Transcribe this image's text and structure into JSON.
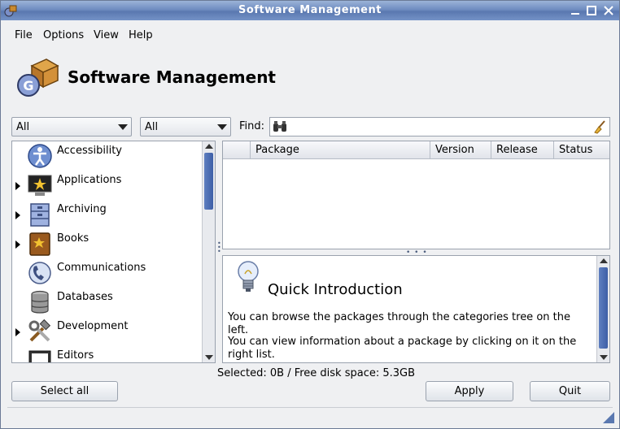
{
  "window": {
    "title": "Software Management"
  },
  "menubar": {
    "items": [
      "File",
      "Options",
      "View",
      "Help"
    ]
  },
  "header": {
    "title": "Software Management"
  },
  "filters": {
    "combo1": "All",
    "combo2": "All",
    "find_label": "Find:",
    "find_value": ""
  },
  "categories": [
    {
      "label": "Accessibility",
      "icon": "accessibility-icon",
      "expandable": false
    },
    {
      "label": "Applications",
      "icon": "applications-icon",
      "expandable": true
    },
    {
      "label": "Archiving",
      "icon": "archiving-icon",
      "expandable": true
    },
    {
      "label": "Books",
      "icon": "books-icon",
      "expandable": true
    },
    {
      "label": "Communications",
      "icon": "communications-icon",
      "expandable": false
    },
    {
      "label": "Databases",
      "icon": "databases-icon",
      "expandable": false
    },
    {
      "label": "Development",
      "icon": "development-icon",
      "expandable": true
    },
    {
      "label": "Editors",
      "icon": "editors-icon",
      "expandable": false
    }
  ],
  "package_list": {
    "columns": [
      "Package",
      "Version",
      "Release",
      "Status"
    ],
    "rows": []
  },
  "info": {
    "title": "Quick Introduction",
    "paragraphs": [
      "You can browse the packages through the categories tree on the left.",
      "You can view information about a package by clicking on it on the right list."
    ]
  },
  "status": {
    "text": "Selected: 0B / Free disk space: 5.3GB"
  },
  "buttons": {
    "select_all": "Select all",
    "apply": "Apply",
    "quit": "Quit"
  },
  "colors": {
    "titlebar": "#6f8cc0",
    "scroll_thumb": "#3d5fa6",
    "background": "#eff0f2"
  }
}
